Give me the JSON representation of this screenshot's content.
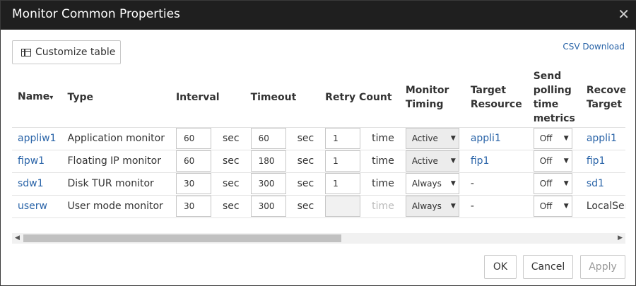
{
  "dialog": {
    "title": "Monitor Common Properties"
  },
  "toolbar": {
    "customize_label": "Customize table",
    "csv_label": "CSV Download"
  },
  "table": {
    "headers": {
      "name": "Name",
      "type": "Type",
      "interval": "Interval",
      "timeout": "Timeout",
      "retry": "Retry Count",
      "timing": "Monitor Timing",
      "target": "Target Resource",
      "polling": "Send polling time metrics",
      "recovery": "Recovery Target"
    },
    "rows": [
      {
        "name": "appliw1",
        "type": "Application monitor",
        "interval": "60",
        "interval_unit": "sec",
        "timeout": "60",
        "timeout_unit": "sec",
        "retry": "1",
        "retry_unit": "time",
        "timing": "Active",
        "target": "appli1",
        "polling": "Off",
        "recovery": "appli1"
      },
      {
        "name": "fipw1",
        "type": "Floating IP monitor",
        "interval": "60",
        "interval_unit": "sec",
        "timeout": "180",
        "timeout_unit": "sec",
        "retry": "1",
        "retry_unit": "time",
        "timing": "Active",
        "target": "fip1",
        "polling": "Off",
        "recovery": "fip1"
      },
      {
        "name": "sdw1",
        "type": "Disk TUR monitor",
        "interval": "30",
        "interval_unit": "sec",
        "timeout": "300",
        "timeout_unit": "sec",
        "retry": "1",
        "retry_unit": "time",
        "timing": "Always",
        "target": "-",
        "polling": "Off",
        "recovery": "sd1"
      },
      {
        "name": "userw",
        "type": "User mode monitor",
        "interval": "30",
        "interval_unit": "sec",
        "timeout": "300",
        "timeout_unit": "sec",
        "retry": "",
        "retry_unit": "time",
        "timing": "Always",
        "target": "-",
        "polling": "Off",
        "recovery": "LocalServer"
      }
    ]
  },
  "footer": {
    "ok_label": "OK",
    "cancel_label": "Cancel",
    "apply_label": "Apply"
  },
  "colors": {
    "titlebar": "#1f1f1f",
    "link": "#2a64a8"
  }
}
